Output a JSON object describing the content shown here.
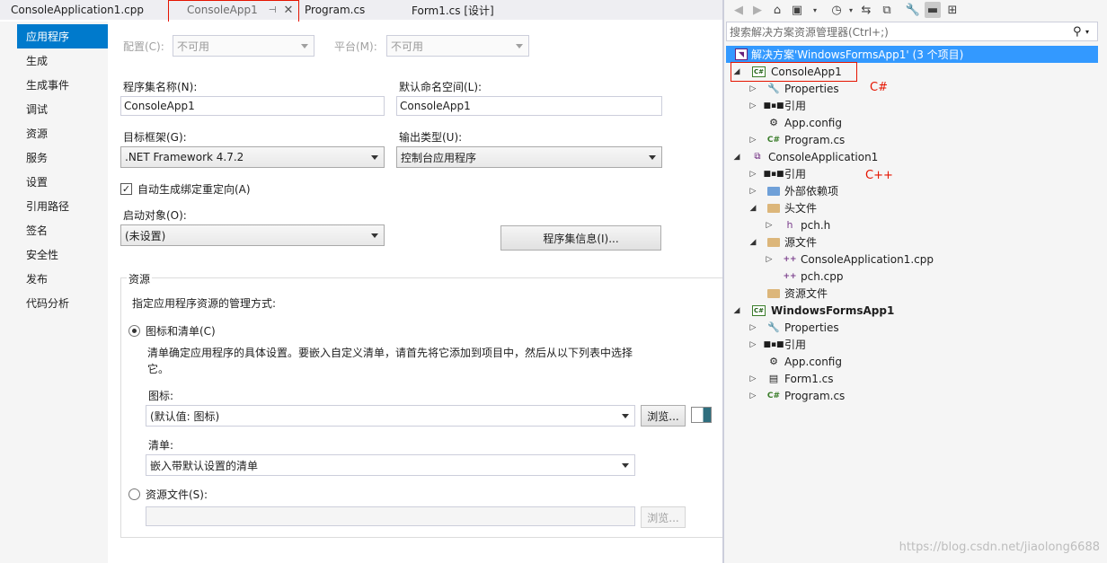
{
  "tabs": [
    {
      "label": "ConsoleApplication1.cpp"
    },
    {
      "label": "ConsoleApp1",
      "active": true
    },
    {
      "label": "Program.cs"
    },
    {
      "label": "Form1.cs [设计]"
    }
  ],
  "tab_icons": {
    "pin": "pin-icon",
    "close": "close-icon"
  },
  "nav": {
    "items": [
      "应用程序",
      "生成",
      "生成事件",
      "调试",
      "资源",
      "服务",
      "设置",
      "引用路径",
      "签名",
      "安全性",
      "发布",
      "代码分析"
    ],
    "selected": "应用程序"
  },
  "config": {
    "config_label": "配置(C):",
    "config_value": "不可用",
    "platform_label": "平台(M):",
    "platform_value": "不可用"
  },
  "app": {
    "assembly_label": "程序集名称(N):",
    "assembly_value": "ConsoleApp1",
    "namespace_label": "默认命名空间(L):",
    "namespace_value": "ConsoleApp1",
    "framework_label": "目标框架(G):",
    "framework_value": ".NET Framework 4.7.2",
    "output_label": "输出类型(U):",
    "output_value": "控制台应用程序",
    "autogen_label": "自动生成绑定重定向(A)",
    "autogen_checked": true,
    "startup_label": "启动对象(O):",
    "startup_value": "(未设置)",
    "assembly_info_btn": "程序集信息(I)..."
  },
  "resources": {
    "group_title": "资源",
    "desc": "指定应用程序资源的管理方式:",
    "icon_manifest_label": "图标和清单(C)",
    "icon_manifest_desc_1": "清单确定应用程序的具体设置。要嵌入自定义清单，请首先将它添加到项目中，然后从以下列表中选择",
    "icon_manifest_desc_2": "它。",
    "icon_label": "图标:",
    "icon_value": "(默认值: 图标)",
    "browse": "浏览...",
    "manifest_label": "清单:",
    "manifest_value": "嵌入带默认设置的清单",
    "resfile_label": "资源文件(S):",
    "resfile_value": "",
    "browse_disabled": "浏览..."
  },
  "solution_explorer": {
    "search_placeholder": "搜索解决方案资源管理器(Ctrl+;)",
    "solution": "解决方案'WindowsFormsApp1' (3 个项目)",
    "nodes": [
      {
        "label": "ConsoleApp1",
        "icon": "csharp-project-icon",
        "bold": false
      },
      {
        "label": "Properties",
        "icon": "wrench-icon"
      },
      {
        "label": "引用",
        "icon": "references-icon"
      },
      {
        "label": "App.config",
        "icon": "config-icon"
      },
      {
        "label": "Program.cs",
        "icon": "csharp-file-icon"
      },
      {
        "label": "ConsoleApplication1",
        "icon": "cpp-project-icon"
      },
      {
        "label": "引用",
        "icon": "references-icon"
      },
      {
        "label": "外部依赖项",
        "icon": "external-deps-icon"
      },
      {
        "label": "头文件",
        "icon": "folder-icon"
      },
      {
        "label": "pch.h",
        "icon": "header-file-icon"
      },
      {
        "label": "源文件",
        "icon": "folder-icon"
      },
      {
        "label": "ConsoleApplication1.cpp",
        "icon": "cpp-file-icon"
      },
      {
        "label": "pch.cpp",
        "icon": "cpp-file-icon"
      },
      {
        "label": "资源文件",
        "icon": "folder-icon"
      },
      {
        "label": "WindowsFormsApp1",
        "icon": "csharp-project-icon",
        "bold": true
      },
      {
        "label": "Properties",
        "icon": "wrench-icon"
      },
      {
        "label": "引用",
        "icon": "references-icon"
      },
      {
        "label": "App.config",
        "icon": "config-icon"
      },
      {
        "label": "Form1.cs",
        "icon": "form-icon"
      },
      {
        "label": "Program.cs",
        "icon": "csharp-file-icon"
      }
    ],
    "annotation_csharp": "C#",
    "annotation_cpp": "C++"
  },
  "watermark": "https://blog.csdn.net/jiaolong6688",
  "colors": {
    "accent": "#007acc",
    "selection": "#3399ff",
    "annotation": "#e51400"
  }
}
